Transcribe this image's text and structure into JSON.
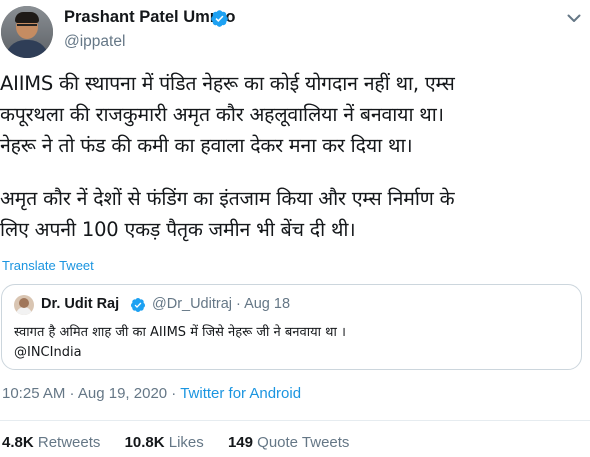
{
  "author": {
    "display_name": "Prashant Patel Umrao",
    "handle": "@ippatel",
    "verified": true
  },
  "tweet": {
    "lines": [
      "AIIMS की स्थापना में पंडित नेहरू का कोई योगदान नहीं था, एम्स",
      "कपूरथला की राजकुमारी अमृत कौर अहलूवालिया नें बनवाया था।",
      "नेहरू ने तो फंड की कमी का हवाला देकर मना कर दिया था।",
      "अमृत कौर नें देशों से फंडिंग का इंतजाम किया और एम्स निर्माण के",
      "लिए अपनी 100 एकड़ पैतृक जमीन भी बेंच दी थी।"
    ],
    "translate_label": "Translate Tweet"
  },
  "quoted": {
    "display_name": "Dr. Udit Raj",
    "verified": true,
    "handle_date": "@Dr_Uditraj · Aug 18",
    "line1": "स्वागत है अमित शाह जी का AIIMS में जिसे नेहरू जी ने बनवाया था ।",
    "line2": "@INCIndia"
  },
  "meta": {
    "time_date": "10:25 AM · Aug 19, 2020 · ",
    "source": "Twitter for Android"
  },
  "stats": {
    "retweets_count": "4.8K",
    "retweets_label": " Retweets",
    "likes_count": "10.8K",
    "likes_label": " Likes",
    "quotes_count": "149",
    "quotes_label": " Quote Tweets"
  },
  "colors": {
    "link": "#1b95e0",
    "secondary_text": "#657786",
    "verified_badge": "#1da1f2"
  },
  "icons": [
    "verified-badge-icon",
    "chevron-down-icon"
  ]
}
